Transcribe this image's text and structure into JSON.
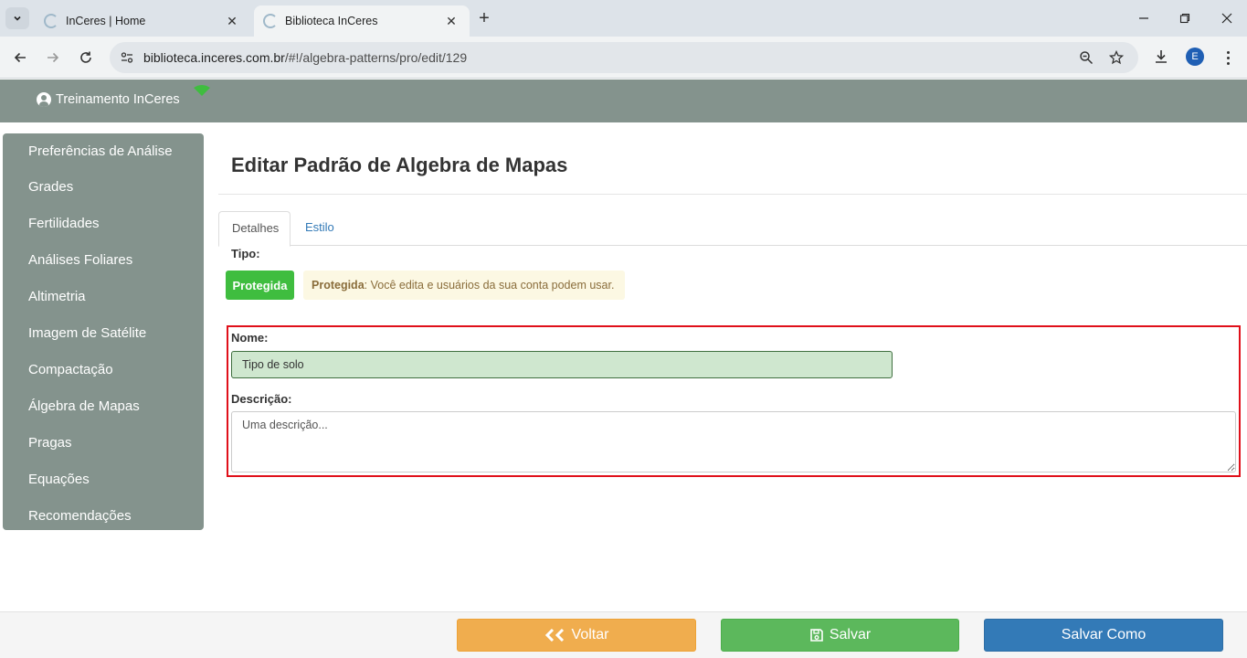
{
  "browser": {
    "tabs": [
      {
        "title": "InCeres | Home",
        "active": false
      },
      {
        "title": "Biblioteca InCeres",
        "active": true
      }
    ],
    "url_host": "biblioteca.inceres.com.br",
    "url_path": "/#!/algebra-patterns/pro/edit/129",
    "profile_initial": "E"
  },
  "header": {
    "user_label": "Treinamento InCeres"
  },
  "sidebar": {
    "items": [
      {
        "label": "Preferências de Análise"
      },
      {
        "label": "Grades"
      },
      {
        "label": "Fertilidades"
      },
      {
        "label": "Análises Foliares"
      },
      {
        "label": "Altimetria"
      },
      {
        "label": "Imagem de Satélite"
      },
      {
        "label": "Compactação"
      },
      {
        "label": "Álgebra de Mapas"
      },
      {
        "label": "Pragas"
      },
      {
        "label": "Equações"
      },
      {
        "label": "Recomendações"
      }
    ]
  },
  "main": {
    "title": "Editar Padrão de Algebra de Mapas",
    "tabs": [
      {
        "label": "Detalhes"
      },
      {
        "label": "Estilo"
      }
    ],
    "type_label": "Tipo:",
    "type_badge": "Protegida",
    "type_info_strong": "Protegida",
    "type_info_text": ": Você edita e usuários da sua conta podem usar.",
    "name_label": "Nome:",
    "name_value": "Tipo de solo",
    "description_label": "Descrição:",
    "description_placeholder": "Uma descrição..."
  },
  "footer": {
    "back_label": "Voltar",
    "save_label": "Salvar",
    "save_as_label": "Salvar Como"
  },
  "colors": {
    "header_bg": "#84938d",
    "badge_green": "#3fbd3f",
    "back_orange": "#f0ad4e",
    "save_green": "#5cb85c",
    "save_as_blue": "#337ab7",
    "highlight_red": "#e0101a"
  }
}
